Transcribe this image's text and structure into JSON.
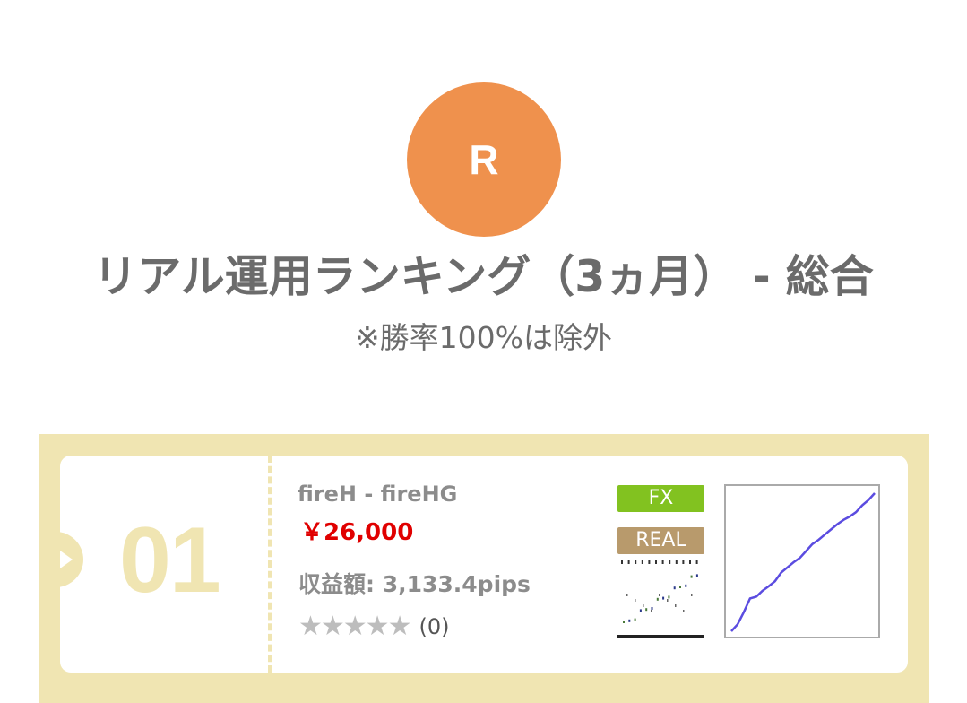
{
  "header": {
    "avatar_letter": "R",
    "title": "リアル運用ランキング（3ヵ月） - 総合",
    "subtitle": "※勝率100%は除外"
  },
  "ranking": [
    {
      "rank": "01",
      "strategy": "fireH - fireHG",
      "price": "￥26,000",
      "profit": "収益額: 3,133.4pips",
      "stars": "★★★★★",
      "review_count": "(0)",
      "tags": [
        "FX",
        "REAL"
      ],
      "chart_data": {
        "type": "line",
        "series": [
          {
            "values": [
              0,
              8,
              22,
              38,
              40,
              47,
              52,
              58,
              68,
              74,
              80,
              85,
              93,
              101,
              106,
              112,
              118,
              124,
              129,
              133,
              138,
              146,
              152,
              160
            ]
          }
        ],
        "color": "#5b4ce0"
      }
    }
  ],
  "colors": {
    "accent": "#ef914d",
    "frame": "#f0e5b2",
    "price": "#e00000",
    "fx_tag": "#82c220",
    "real_tag": "#b89a6c"
  }
}
